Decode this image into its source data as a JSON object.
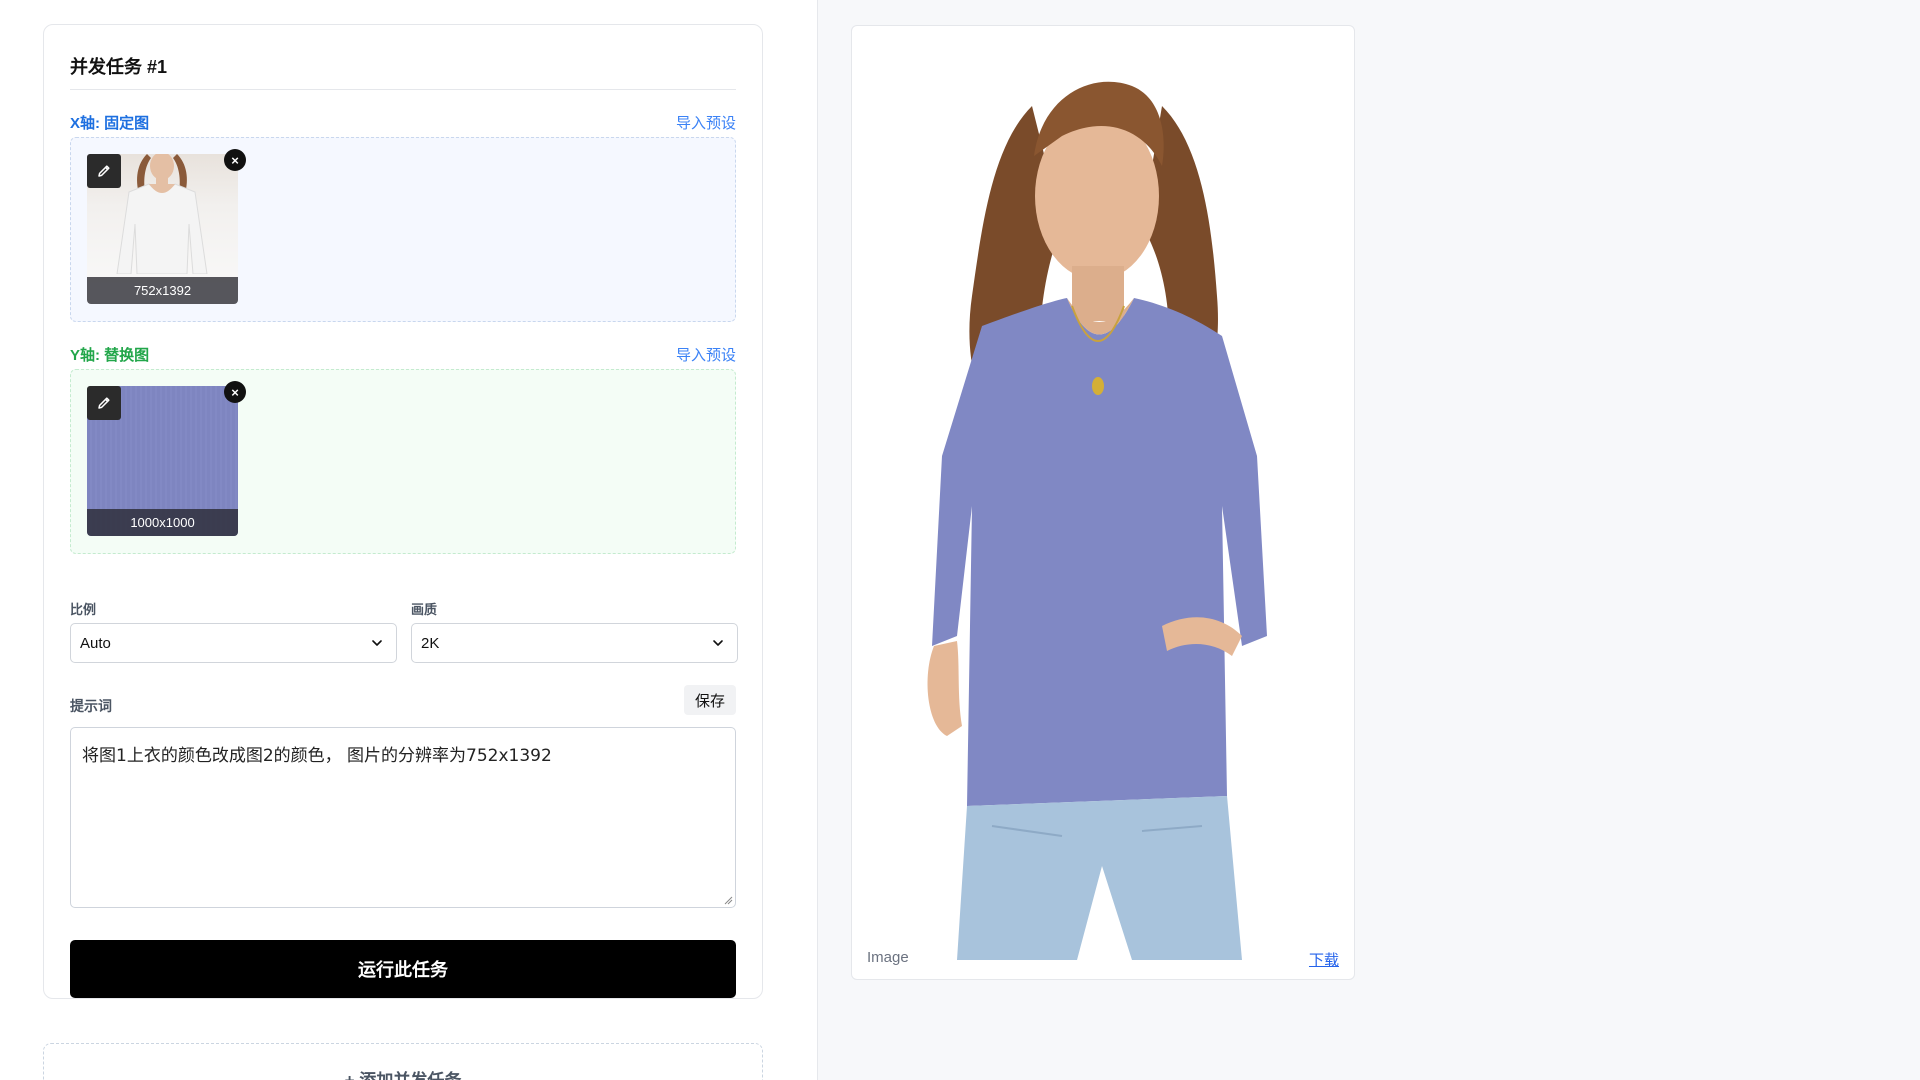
{
  "task": {
    "title": "并发任务 #1",
    "x_axis": {
      "label": "X轴: 固定图",
      "preset_link": "导入预设",
      "image": {
        "caption": "752x1392",
        "icon": "pencil-icon"
      }
    },
    "y_axis": {
      "label": "Y轴: 替换图",
      "preset_link": "导入预设",
      "image": {
        "caption": "1000x1000",
        "icon": "pencil-icon"
      }
    },
    "ratio": {
      "label": "比例",
      "value": "Auto"
    },
    "quality": {
      "label": "画质",
      "value": "2K"
    },
    "prompt": {
      "label": "提示词",
      "save_label": "保存",
      "value": "将图1上衣的颜色改成图2的颜色， 图片的分辨率为752x1392"
    },
    "run_label": "运行此任务",
    "remove_glyph": "×"
  },
  "add_task_label": "+ 添加并发任务",
  "result": {
    "label": "Image",
    "download_label": "下载"
  },
  "colors": {
    "x_axis": "#1d6fe0",
    "y_axis": "#22a64a",
    "link": "#3b82f6",
    "shirt": "#8088c4",
    "run_button": "#000000"
  }
}
